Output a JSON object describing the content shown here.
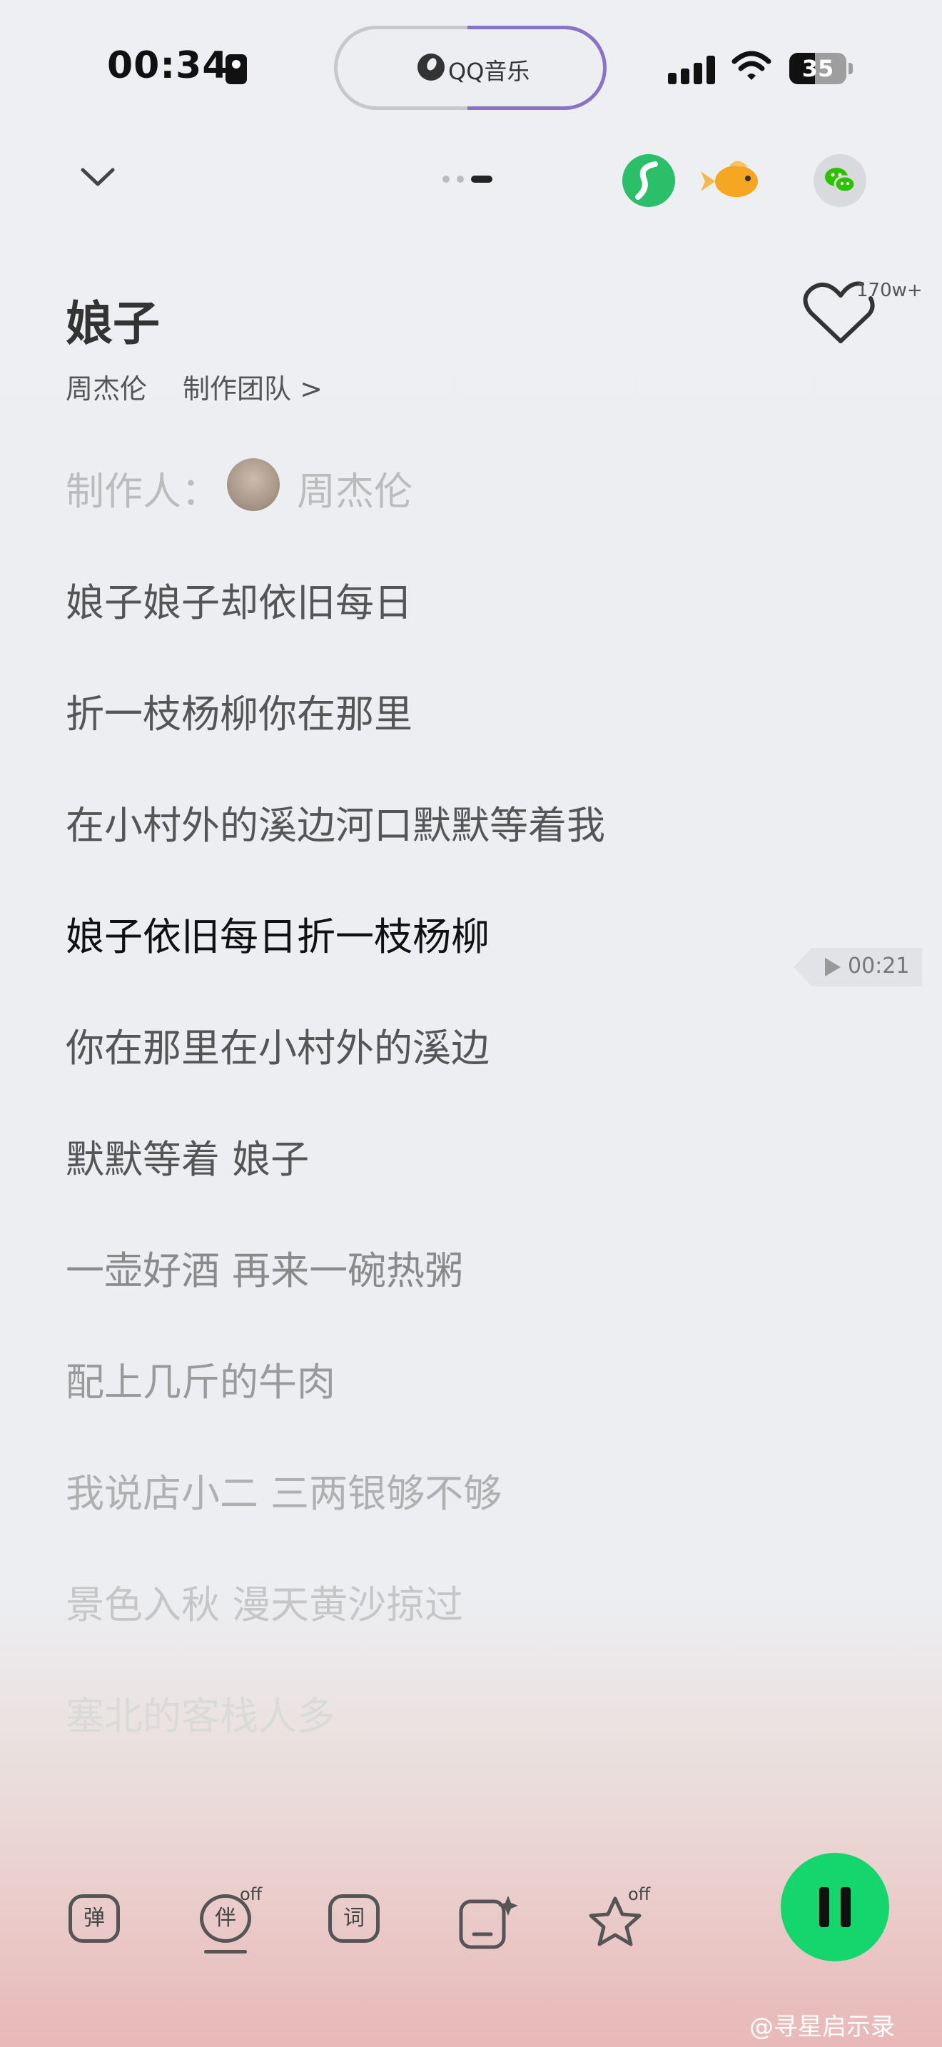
{
  "status_bar": {
    "time": "00:34",
    "island_app": "QQ音乐",
    "battery": "35"
  },
  "header": {
    "collapse_icon": "chevron-down-icon",
    "page_indicator": {
      "count": 3,
      "active": 3
    },
    "share_icons": [
      "green-app-icon",
      "goldfish-app-icon",
      "wechat-icon"
    ]
  },
  "song": {
    "title": "娘子",
    "artist": "周杰伦",
    "team_link": "制作团队 >",
    "like_count": "170w+"
  },
  "lyrics": {
    "producer_label": "制作人：",
    "producer_name": "周杰伦",
    "lines": [
      "娘子娘子却依旧每日",
      "折一枝杨柳你在那里",
      "在小村外的溪边河口默默等着我",
      "娘子依旧每日折一枝杨柳",
      "你在那里在小村外的溪边",
      "默默等着 娘子",
      "一壶好酒 再来一碗热粥",
      "配上几斤的牛肉",
      "我说店小二 三两银够不够",
      "景色入秋 漫天黄沙掠过",
      "塞北的客栈人多"
    ],
    "current_line_index": 3,
    "seek_time": "00:21"
  },
  "toolbar": {
    "danmaku_label": "弹",
    "accompany_label": "伴",
    "accompany_state": "off",
    "lyrics_label": "词",
    "favorite_state": "off"
  },
  "watermark": "@寻星启示录",
  "colors": {
    "accent_green": "#14d66c",
    "island_progress": "#8a72c9"
  }
}
